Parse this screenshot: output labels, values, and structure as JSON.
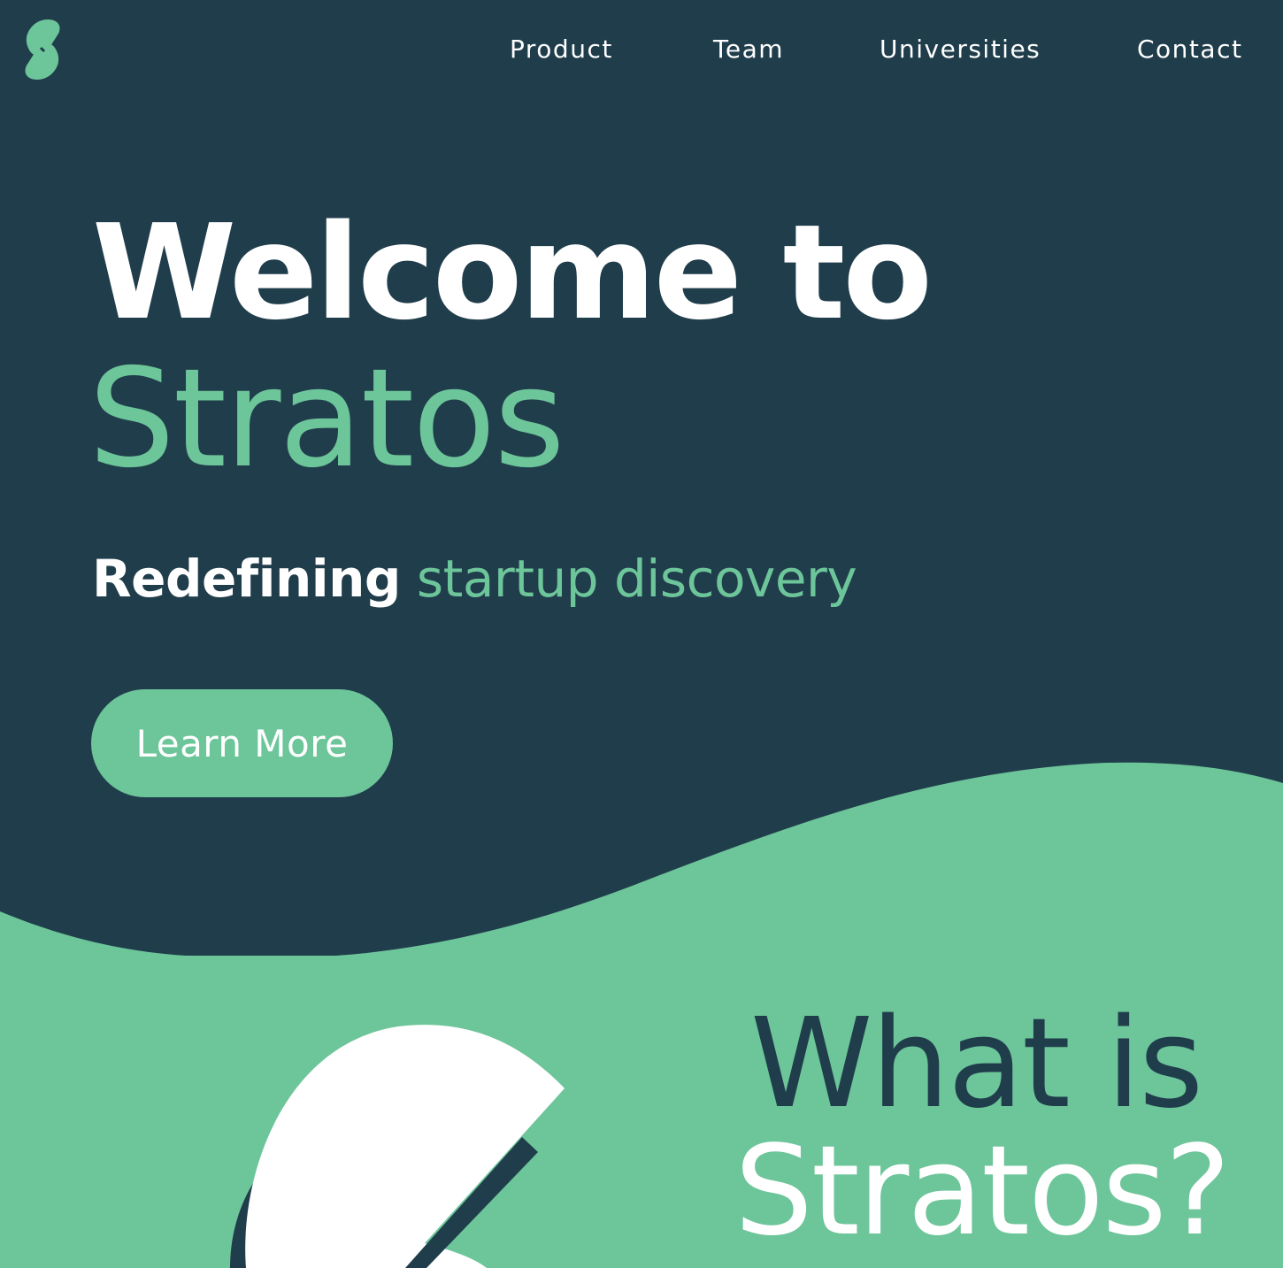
{
  "brand": {
    "logo_icon": "stratos-s-logo-icon",
    "primary_color": "#203d4b",
    "accent_color": "#6dc59a"
  },
  "nav": {
    "items": [
      {
        "label": "Product"
      },
      {
        "label": "Team"
      },
      {
        "label": "Universities"
      },
      {
        "label": "Contact"
      }
    ]
  },
  "hero": {
    "title_line1": "Welcome to",
    "title_line2": "Stratos",
    "tagline_part1": "Redefining",
    "tagline_part2": "startup discovery",
    "cta_label": "Learn More"
  },
  "about": {
    "heading_line1": "What is",
    "heading_line2": "Stratos?",
    "illustration_icon": "abstract-shape-illustration"
  }
}
